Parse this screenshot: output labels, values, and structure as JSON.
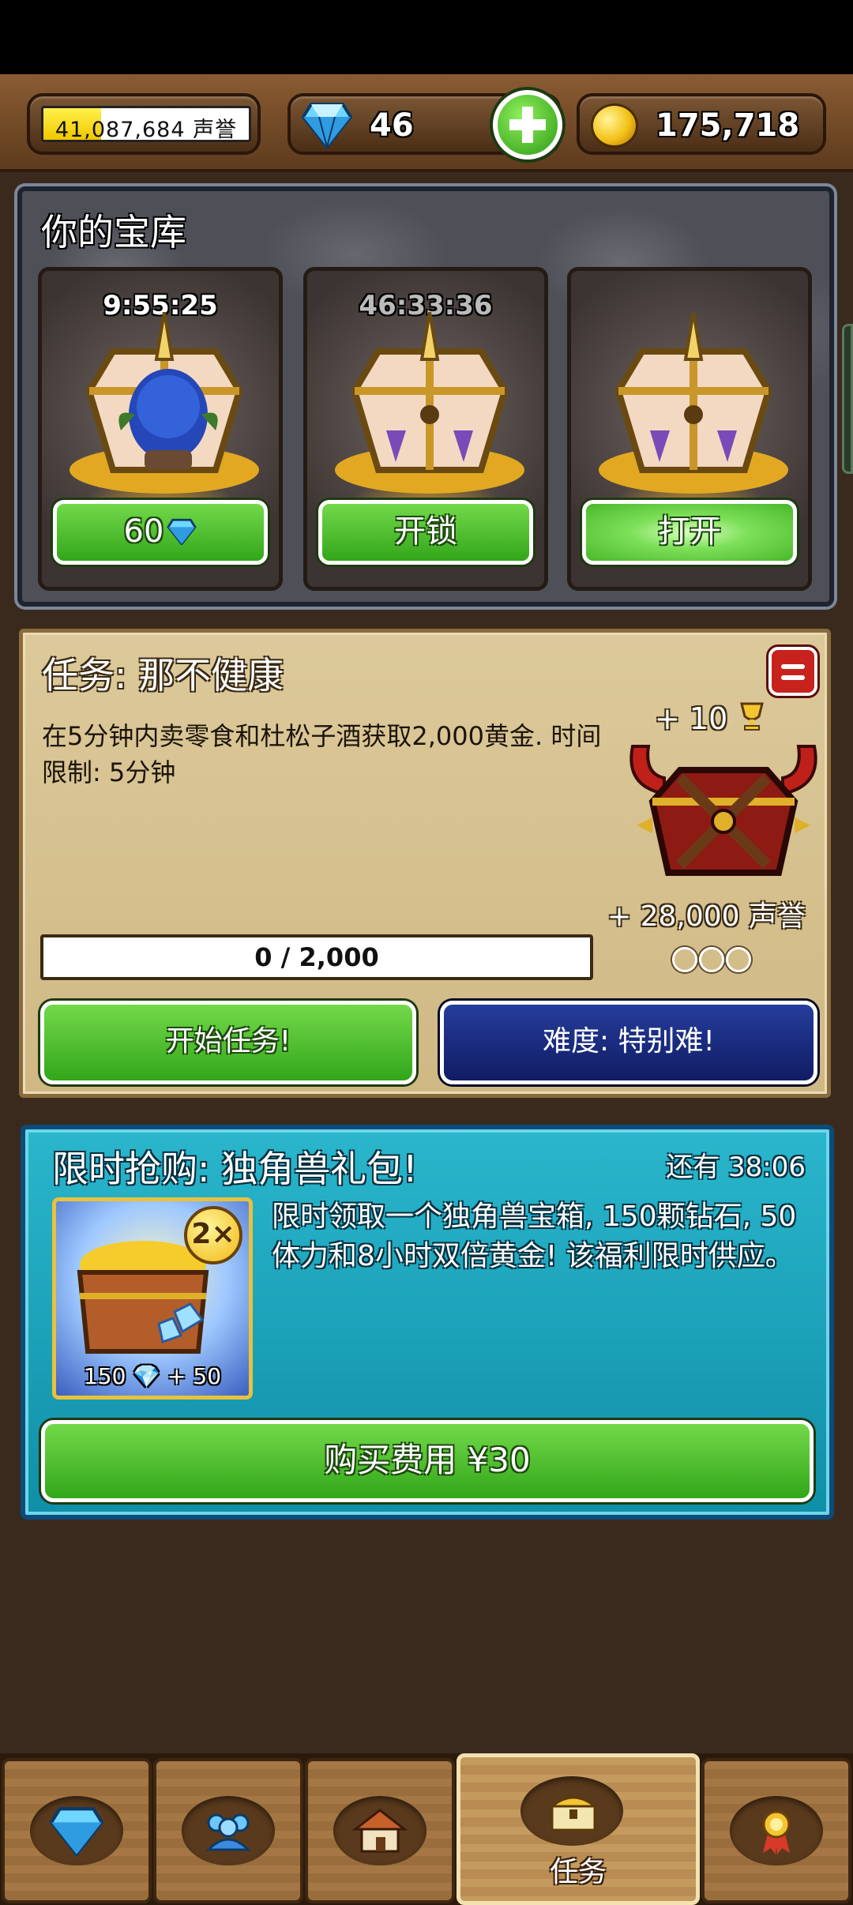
{
  "topbar": {
    "reputation": {
      "value": "41,087,684",
      "unit": "声誉",
      "progress_percent": 28
    },
    "gems": "46",
    "gold": "175,718"
  },
  "vault": {
    "title": "你的宝库",
    "slots": [
      {
        "timer": "9:55:25",
        "button": "60",
        "button_icon": "diamond-icon"
      },
      {
        "timer": "46:33:36",
        "button": "开锁"
      },
      {
        "timer": "",
        "button": "打开"
      }
    ]
  },
  "quest": {
    "title": "任务: 那不健康",
    "description": "在5分钟内卖零食和杜松子酒获取2,000黄金. 时间限制: 5分钟",
    "reward_trophies": "+ 10",
    "reward_reputation": "+ 28,000 声誉",
    "progress": "0 / 2,000",
    "progress_fraction": 0,
    "difficulty_marks": 3,
    "start_button": "开始任务!",
    "difficulty_button": "难度: 特别难!"
  },
  "offer": {
    "title": "限时抢购: 独角兽礼包!",
    "timer": "还有 38:06",
    "pack_label": "150 💎 + 50",
    "pack_badge": "2×",
    "description": "限时领取一个独角兽宝箱, 150颗钻石, 50体力和8小时双倍黄金! 该福利限时供应。",
    "buy_button": "购买费用 ¥30"
  },
  "nav": {
    "tabs": [
      {
        "icon": "diamond-icon",
        "label": ""
      },
      {
        "icon": "people-icon",
        "label": ""
      },
      {
        "icon": "shop-icon",
        "label": ""
      },
      {
        "icon": "treasure-chest-icon",
        "label": "任务",
        "active": true
      },
      {
        "icon": "medal-icon",
        "label": ""
      }
    ]
  },
  "colors": {
    "green_button": "#3aab1f",
    "blue_button": "#1a2a80",
    "offer_bg": "#1aa3bb",
    "parchment": "#d6c290"
  }
}
